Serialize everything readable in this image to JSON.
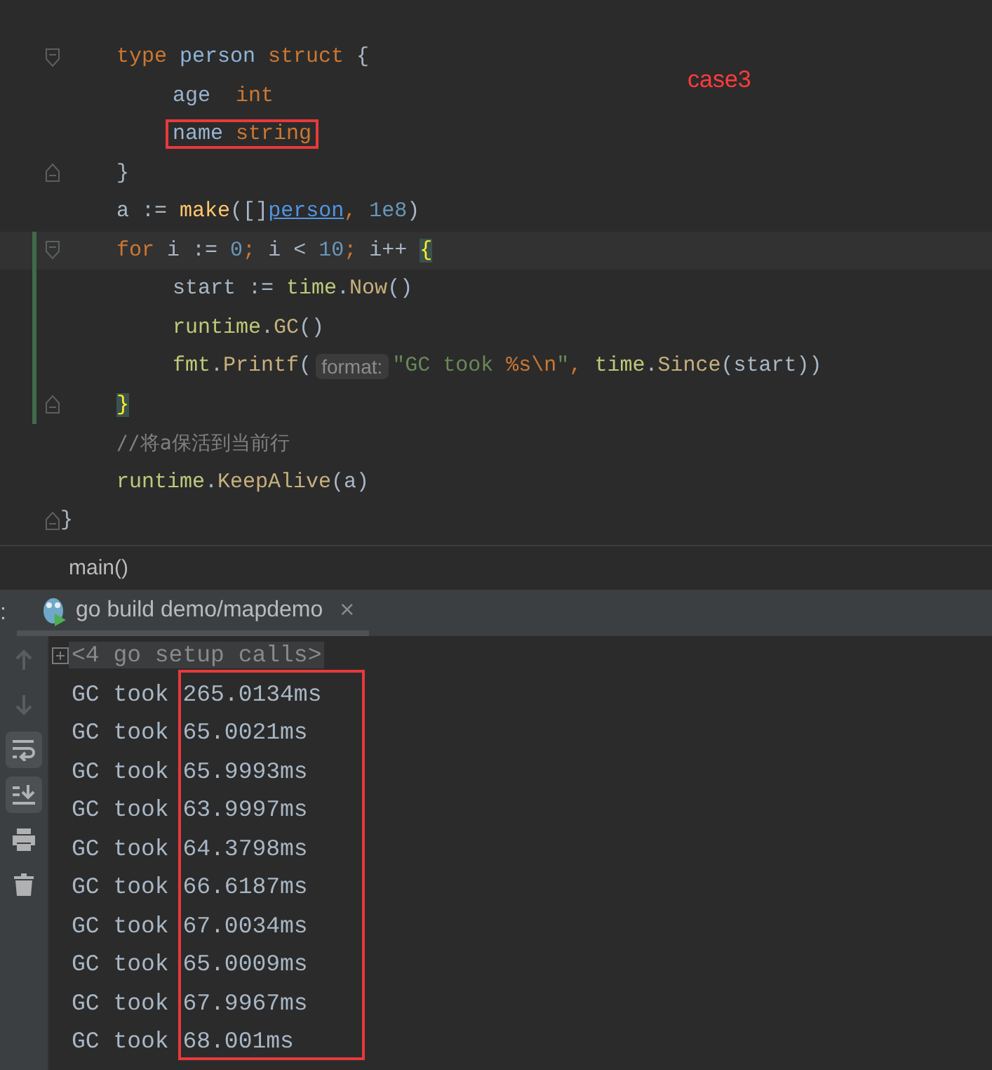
{
  "editor": {
    "annotation": {
      "text": "case3"
    },
    "lines": [
      {
        "kind": "fold_start",
        "tokens": [
          {
            "kind": "keyword",
            "text": "type "
          },
          {
            "kind": "type",
            "text": "person "
          },
          {
            "kind": "keyword",
            "text": "struct "
          },
          {
            "kind": "punct",
            "text": "{"
          }
        ],
        "children": [
          {
            "tokens": [
              {
                "kind": "field",
                "text": "age  "
              },
              {
                "kind": "keyword",
                "text": "int"
              }
            ]
          },
          {
            "boxed": true,
            "tokens": [
              {
                "kind": "field",
                "text": "name "
              },
              {
                "kind": "keyword",
                "text": "string"
              }
            ]
          }
        ],
        "end": {
          "kind": "fold_end",
          "tokens": [
            {
              "kind": "punct",
              "text": "}"
            }
          ]
        }
      },
      {
        "tokens": [
          {
            "kind": "ident",
            "text": "a"
          },
          {
            "kind": "punct",
            "text": " := "
          },
          {
            "kind": "builtin",
            "text": "make"
          },
          {
            "kind": "punct",
            "text": "([]"
          },
          {
            "kind": "link",
            "text": "person"
          },
          {
            "kind": "keyword",
            "text": ", "
          },
          {
            "kind": "number",
            "text": "1e8"
          },
          {
            "kind": "punct",
            "text": ")"
          }
        ]
      },
      {
        "kind": "fold_start",
        "changed": true,
        "current": true,
        "tokens": [
          {
            "kind": "keyword",
            "text": "for"
          },
          {
            "kind": "ident",
            "text": " i := "
          },
          {
            "kind": "number",
            "text": "0"
          },
          {
            "kind": "keyword",
            "text": ";"
          },
          {
            "kind": "ident",
            "text": " i < "
          },
          {
            "kind": "number",
            "text": "10"
          },
          {
            "kind": "keyword",
            "text": ";"
          },
          {
            "kind": "ident",
            "text": " i++ "
          },
          {
            "kind": "brace_match",
            "text": "{"
          }
        ],
        "children": [
          {
            "changed": true,
            "tokens": [
              {
                "kind": "ident",
                "text": "start := "
              },
              {
                "kind": "package",
                "text": "time"
              },
              {
                "kind": "punct",
                "text": "."
              },
              {
                "kind": "func",
                "text": "Now"
              },
              {
                "kind": "punct",
                "text": "()"
              }
            ]
          },
          {
            "changed": true,
            "tokens": [
              {
                "kind": "package",
                "text": "runtime"
              },
              {
                "kind": "punct",
                "text": "."
              },
              {
                "kind": "func",
                "text": "GC"
              },
              {
                "kind": "punct",
                "text": "()"
              }
            ]
          },
          {
            "changed": true,
            "tokens": [
              {
                "kind": "package",
                "text": "fmt"
              },
              {
                "kind": "punct",
                "text": "."
              },
              {
                "kind": "func",
                "text": "Printf"
              },
              {
                "kind": "punct",
                "text": "("
              },
              {
                "kind": "hint",
                "text": "format:"
              },
              {
                "kind": "string",
                "text": "\"GC took "
              },
              {
                "kind": "escape",
                "text": "%s\\n"
              },
              {
                "kind": "string",
                "text": "\""
              },
              {
                "kind": "keyword",
                "text": ", "
              },
              {
                "kind": "package",
                "text": "time"
              },
              {
                "kind": "punct",
                "text": "."
              },
              {
                "kind": "func",
                "text": "Since"
              },
              {
                "kind": "punct",
                "text": "(start))"
              }
            ]
          }
        ],
        "end": {
          "kind": "fold_end",
          "changed": true,
          "tokens": [
            {
              "kind": "brace_match",
              "text": "}"
            }
          ]
        }
      },
      {
        "tokens": [
          {
            "kind": "comment",
            "text": "//将a保活到当前行"
          }
        ]
      },
      {
        "tokens": [
          {
            "kind": "package",
            "text": "runtime"
          },
          {
            "kind": "punct",
            "text": "."
          },
          {
            "kind": "func",
            "text": "KeepAlive"
          },
          {
            "kind": "punct",
            "text": "(a)"
          }
        ]
      }
    ],
    "closing": {
      "kind": "fold_end",
      "tokens": [
        {
          "kind": "punct",
          "text": "}"
        }
      ]
    }
  },
  "breadcrumb": "main()",
  "run_panel": {
    "edge_text": ":",
    "tabs": [
      {
        "label": "go build demo/mapdemo",
        "selected": true,
        "close": "×"
      }
    ],
    "toolbar": [
      {
        "kind": "up",
        "on": false,
        "disabled": true
      },
      {
        "kind": "down",
        "on": false,
        "disabled": true
      },
      {
        "kind": "wrap",
        "on": true,
        "disabled": false
      },
      {
        "kind": "scroll_end",
        "on": true,
        "disabled": false
      },
      {
        "kind": "print",
        "on": false,
        "disabled": false
      },
      {
        "kind": "trash",
        "on": false,
        "disabled": false
      }
    ],
    "console": [
      {
        "kind": "folded",
        "text": "<4 go setup calls>"
      },
      {
        "kind": "output",
        "text": "GC took 265.0134ms"
      },
      {
        "kind": "output",
        "text": "GC took 65.0021ms"
      },
      {
        "kind": "output",
        "text": "GC took 65.9993ms"
      },
      {
        "kind": "output",
        "text": "GC took 63.9997ms"
      },
      {
        "kind": "output",
        "text": "GC took 64.3798ms"
      },
      {
        "kind": "output",
        "text": "GC took 66.6187ms"
      },
      {
        "kind": "output",
        "text": "GC took 67.0034ms"
      },
      {
        "kind": "output",
        "text": "GC took 65.0009ms"
      },
      {
        "kind": "output",
        "text": "GC took 67.9967ms"
      },
      {
        "kind": "output",
        "text": "GC took 68.001ms"
      }
    ]
  }
}
